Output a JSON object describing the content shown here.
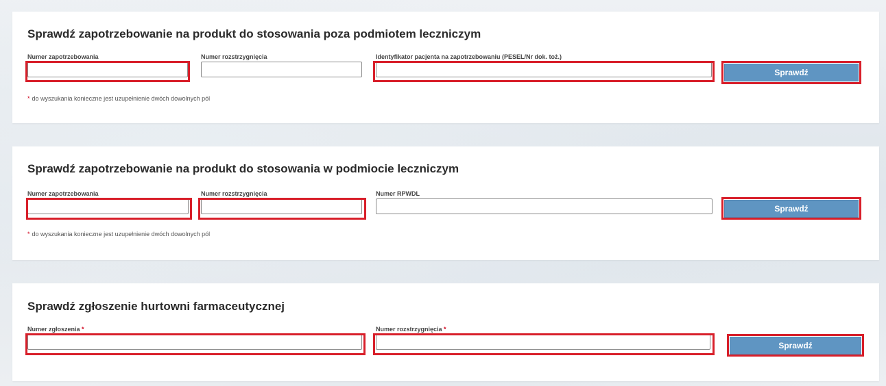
{
  "section1": {
    "title": "Sprawdź zapotrzebowanie na produkt do stosowania poza podmiotem leczniczym",
    "fields": {
      "demand_number": {
        "label": "Numer zapotrzebowania",
        "value": ""
      },
      "decision_number": {
        "label": "Numer rozstrzygnięcia",
        "value": ""
      },
      "patient_id": {
        "label": "Identyfikator pacjenta na zapotrzebowaniu (PESEL/Nr dok. toż.)",
        "value": ""
      }
    },
    "button_label": "Sprawdź",
    "note_marker": "*",
    "note": "do wyszukania konieczne jest uzupełnienie dwóch dowolnych pól"
  },
  "section2": {
    "title": "Sprawdź zapotrzebowanie na produkt do stosowania w podmiocie leczniczym",
    "fields": {
      "demand_number": {
        "label": "Numer zapotrzebowania",
        "value": ""
      },
      "decision_number": {
        "label": "Numer rozstrzygnięcia",
        "value": ""
      },
      "rpwdl_number": {
        "label": "Numer RPWDL",
        "value": ""
      }
    },
    "button_label": "Sprawdź",
    "note_marker": "*",
    "note": "do wyszukania konieczne jest uzupełnienie dwóch dowolnych pól"
  },
  "section3": {
    "title": "Sprawdź zgłoszenie hurtowni farmaceutycznej",
    "fields": {
      "notification_number": {
        "label": "Numer zgłoszenia",
        "required_marker": "*",
        "value": ""
      },
      "decision_number": {
        "label": "Numer rozstrzygnięcia",
        "required_marker": "*",
        "value": ""
      }
    },
    "button_label": "Sprawdź"
  },
  "colors": {
    "button_bg": "#5f95c2",
    "highlight": "#d81f2a",
    "required": "#d0021b"
  }
}
